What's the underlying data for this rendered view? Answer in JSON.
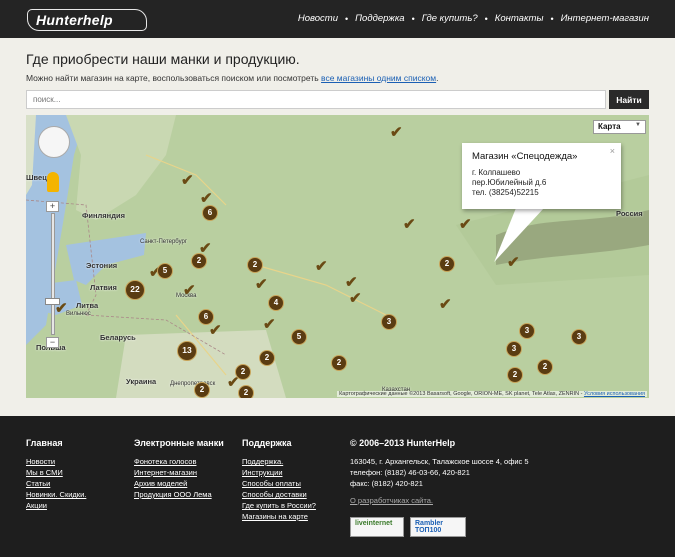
{
  "header": {
    "logo_text": "Hunterhelp",
    "nav": [
      "Новости",
      "Поддержка",
      "Где купить?",
      "Контакты",
      "Интернет-магазин"
    ]
  },
  "main": {
    "title": "Где приобрести наши манки и продукцию.",
    "intro_text": "Можно найти магазин на карте, воспользоваться поиском или посмотреть",
    "intro_link": "все магазины одним списком",
    "intro_end": ".",
    "search_placeholder": "поиск...",
    "search_button": "Найти"
  },
  "map": {
    "map_type": "Карта",
    "attribution": "Картографические данные ©2013 Basarsoft, Google, ORION-ME, SK planet, Tele Atlas, ZENRIN -",
    "attribution_link": "Условия использования",
    "labels": [
      "Швеция",
      "Финляндия",
      "Эстония",
      "Латвия",
      "Литва",
      "Польша",
      "Беларусь",
      "Украина",
      "Россия",
      "Санкт-Петербург",
      "Москва",
      "Вильнюс",
      "Днепропетровск",
      "Казахстан"
    ],
    "clusters": [
      "6",
      "2",
      "5",
      "22",
      "2",
      "6",
      "4",
      "13",
      "5",
      "3",
      "2",
      "2",
      "2",
      "2",
      "2",
      "2",
      "3",
      "3",
      "3",
      "2",
      "2",
      "6"
    ],
    "infowindow": {
      "title": "Магазин «Спецодежда»",
      "lines": [
        "г. Колпашево",
        "пер.Юбилейный д.6",
        "тел. (38254)52215"
      ],
      "close": "×"
    },
    "pin_symbol": "✔",
    "colors": {
      "cluster_fill": "#5a3c12",
      "pin": "#6a4a14",
      "land": "#b9cfa0",
      "water": "#a4c2e0"
    }
  },
  "footer": {
    "col1": {
      "heading": "Главная",
      "links": [
        "Новости",
        "Мы в СМИ",
        "Статьи",
        "Новинки. Скидки.",
        "Акции"
      ]
    },
    "col2": {
      "heading": "Электронные манки",
      "links": [
        "Фонотека голосов",
        "Интернет-магазин",
        "Архив моделей",
        "Продукция ООО Лема"
      ]
    },
    "col3": {
      "heading": "Поддержка",
      "links": [
        "Поддержка.",
        "Инструкции",
        "Способы оплаты",
        "Способы доставки",
        "Где купить в России?",
        "Магазины на карте"
      ]
    },
    "col4": {
      "heading": "© 2006–2013 HunterHelp",
      "address": "163045, г. Архангельск, Талажское шоссе 4, офис 5",
      "phone": "телефон: (8182) 46-03-66, 420-821",
      "fax": "факс: (8182) 420-821",
      "dev_link": "О разработчиках сайта.",
      "badges": [
        "liveinternet",
        "Rambler ТОП100"
      ]
    }
  }
}
